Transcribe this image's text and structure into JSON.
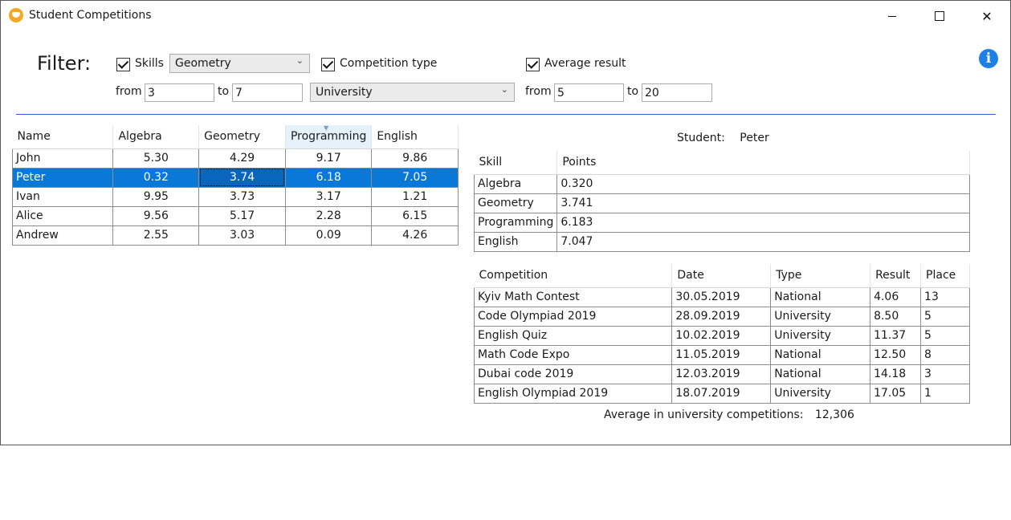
{
  "window": {
    "title": "Student Competitions"
  },
  "filter": {
    "label": "Filter:",
    "skills": {
      "label": "Skills",
      "checked": true,
      "selected": "Geometry",
      "from_label": "from",
      "from": "3",
      "to_label": "to",
      "to": "7"
    },
    "competition_type": {
      "label": "Competition type",
      "checked": true,
      "selected": "University"
    },
    "average_result": {
      "label": "Average result",
      "checked": true,
      "from_label": "from",
      "from": "5",
      "to_label": "to",
      "to": "20"
    }
  },
  "students_table": {
    "columns": [
      "Name",
      "Algebra",
      "Geometry",
      "Programming",
      "English"
    ],
    "sorted_column": "Programming",
    "rows": [
      [
        "John",
        "5.30",
        "4.29",
        "9.17",
        "9.86"
      ],
      [
        "Peter",
        "0.32",
        "3.74",
        "6.18",
        "7.05"
      ],
      [
        "Ivan",
        "9.95",
        "3.73",
        "3.17",
        "1.21"
      ],
      [
        "Alice",
        "9.56",
        "5.17",
        "2.28",
        "6.15"
      ],
      [
        "Andrew",
        "2.55",
        "3.03",
        "0.09",
        "4.26"
      ]
    ],
    "selected_row": "Peter"
  },
  "detail": {
    "student_label": "Student:",
    "student_name": "Peter",
    "skills_table": {
      "columns": [
        "Skill",
        "Points"
      ],
      "rows": [
        [
          "Algebra",
          "0.320"
        ],
        [
          "Geometry",
          "3.741"
        ],
        [
          "Programming",
          "6.183"
        ],
        [
          "English",
          "7.047"
        ]
      ]
    },
    "competitions_table": {
      "columns": [
        "Competition",
        "Date",
        "Type",
        "Result",
        "Place"
      ],
      "rows": [
        [
          "Kyiv Math Contest",
          "30.05.2019",
          "National",
          "4.06",
          "13"
        ],
        [
          "Code Olympiad 2019",
          "28.09.2019",
          "University",
          "8.50",
          "5"
        ],
        [
          "English Quiz",
          "10.02.2019",
          "University",
          "11.37",
          "5"
        ],
        [
          "Math Code Expo",
          "11.05.2019",
          "National",
          "12.50",
          "8"
        ],
        [
          "Dubai code 2019",
          "12.03.2019",
          "National",
          "14.18",
          "3"
        ],
        [
          "English Olympiad 2019",
          "18.07.2019",
          "University",
          "17.05",
          "1"
        ]
      ]
    },
    "average_label": "Average in university competitions:",
    "average_value": "12,306"
  }
}
